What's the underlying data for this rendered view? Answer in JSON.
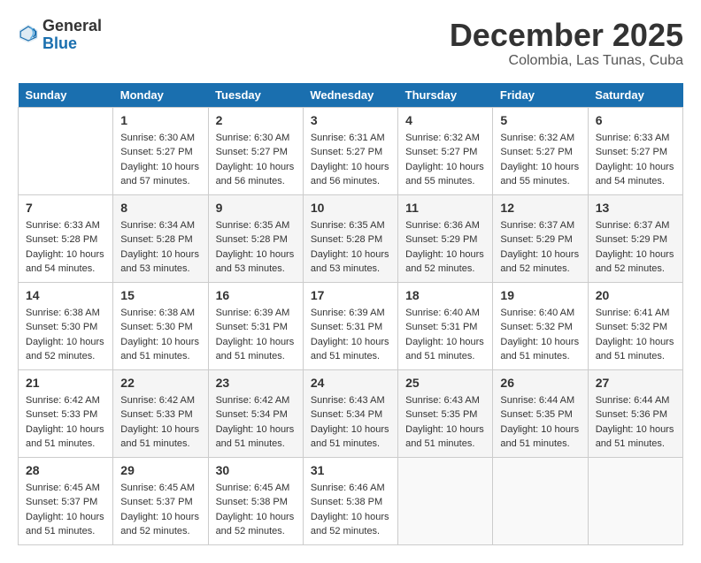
{
  "logo": {
    "general": "General",
    "blue": "Blue"
  },
  "title": {
    "month_year": "December 2025",
    "location": "Colombia, Las Tunas, Cuba"
  },
  "days_of_week": [
    "Sunday",
    "Monday",
    "Tuesday",
    "Wednesday",
    "Thursday",
    "Friday",
    "Saturday"
  ],
  "weeks": [
    [
      {
        "day": "",
        "info": ""
      },
      {
        "day": "1",
        "info": "Sunrise: 6:30 AM\nSunset: 5:27 PM\nDaylight: 10 hours\nand 57 minutes."
      },
      {
        "day": "2",
        "info": "Sunrise: 6:30 AM\nSunset: 5:27 PM\nDaylight: 10 hours\nand 56 minutes."
      },
      {
        "day": "3",
        "info": "Sunrise: 6:31 AM\nSunset: 5:27 PM\nDaylight: 10 hours\nand 56 minutes."
      },
      {
        "day": "4",
        "info": "Sunrise: 6:32 AM\nSunset: 5:27 PM\nDaylight: 10 hours\nand 55 minutes."
      },
      {
        "day": "5",
        "info": "Sunrise: 6:32 AM\nSunset: 5:27 PM\nDaylight: 10 hours\nand 55 minutes."
      },
      {
        "day": "6",
        "info": "Sunrise: 6:33 AM\nSunset: 5:27 PM\nDaylight: 10 hours\nand 54 minutes."
      }
    ],
    [
      {
        "day": "7",
        "info": "Sunrise: 6:33 AM\nSunset: 5:28 PM\nDaylight: 10 hours\nand 54 minutes."
      },
      {
        "day": "8",
        "info": "Sunrise: 6:34 AM\nSunset: 5:28 PM\nDaylight: 10 hours\nand 53 minutes."
      },
      {
        "day": "9",
        "info": "Sunrise: 6:35 AM\nSunset: 5:28 PM\nDaylight: 10 hours\nand 53 minutes."
      },
      {
        "day": "10",
        "info": "Sunrise: 6:35 AM\nSunset: 5:28 PM\nDaylight: 10 hours\nand 53 minutes."
      },
      {
        "day": "11",
        "info": "Sunrise: 6:36 AM\nSunset: 5:29 PM\nDaylight: 10 hours\nand 52 minutes."
      },
      {
        "day": "12",
        "info": "Sunrise: 6:37 AM\nSunset: 5:29 PM\nDaylight: 10 hours\nand 52 minutes."
      },
      {
        "day": "13",
        "info": "Sunrise: 6:37 AM\nSunset: 5:29 PM\nDaylight: 10 hours\nand 52 minutes."
      }
    ],
    [
      {
        "day": "14",
        "info": "Sunrise: 6:38 AM\nSunset: 5:30 PM\nDaylight: 10 hours\nand 52 minutes."
      },
      {
        "day": "15",
        "info": "Sunrise: 6:38 AM\nSunset: 5:30 PM\nDaylight: 10 hours\nand 51 minutes."
      },
      {
        "day": "16",
        "info": "Sunrise: 6:39 AM\nSunset: 5:31 PM\nDaylight: 10 hours\nand 51 minutes."
      },
      {
        "day": "17",
        "info": "Sunrise: 6:39 AM\nSunset: 5:31 PM\nDaylight: 10 hours\nand 51 minutes."
      },
      {
        "day": "18",
        "info": "Sunrise: 6:40 AM\nSunset: 5:31 PM\nDaylight: 10 hours\nand 51 minutes."
      },
      {
        "day": "19",
        "info": "Sunrise: 6:40 AM\nSunset: 5:32 PM\nDaylight: 10 hours\nand 51 minutes."
      },
      {
        "day": "20",
        "info": "Sunrise: 6:41 AM\nSunset: 5:32 PM\nDaylight: 10 hours\nand 51 minutes."
      }
    ],
    [
      {
        "day": "21",
        "info": "Sunrise: 6:42 AM\nSunset: 5:33 PM\nDaylight: 10 hours\nand 51 minutes."
      },
      {
        "day": "22",
        "info": "Sunrise: 6:42 AM\nSunset: 5:33 PM\nDaylight: 10 hours\nand 51 minutes."
      },
      {
        "day": "23",
        "info": "Sunrise: 6:42 AM\nSunset: 5:34 PM\nDaylight: 10 hours\nand 51 minutes."
      },
      {
        "day": "24",
        "info": "Sunrise: 6:43 AM\nSunset: 5:34 PM\nDaylight: 10 hours\nand 51 minutes."
      },
      {
        "day": "25",
        "info": "Sunrise: 6:43 AM\nSunset: 5:35 PM\nDaylight: 10 hours\nand 51 minutes."
      },
      {
        "day": "26",
        "info": "Sunrise: 6:44 AM\nSunset: 5:35 PM\nDaylight: 10 hours\nand 51 minutes."
      },
      {
        "day": "27",
        "info": "Sunrise: 6:44 AM\nSunset: 5:36 PM\nDaylight: 10 hours\nand 51 minutes."
      }
    ],
    [
      {
        "day": "28",
        "info": "Sunrise: 6:45 AM\nSunset: 5:37 PM\nDaylight: 10 hours\nand 51 minutes."
      },
      {
        "day": "29",
        "info": "Sunrise: 6:45 AM\nSunset: 5:37 PM\nDaylight: 10 hours\nand 52 minutes."
      },
      {
        "day": "30",
        "info": "Sunrise: 6:45 AM\nSunset: 5:38 PM\nDaylight: 10 hours\nand 52 minutes."
      },
      {
        "day": "31",
        "info": "Sunrise: 6:46 AM\nSunset: 5:38 PM\nDaylight: 10 hours\nand 52 minutes."
      },
      {
        "day": "",
        "info": ""
      },
      {
        "day": "",
        "info": ""
      },
      {
        "day": "",
        "info": ""
      }
    ]
  ]
}
